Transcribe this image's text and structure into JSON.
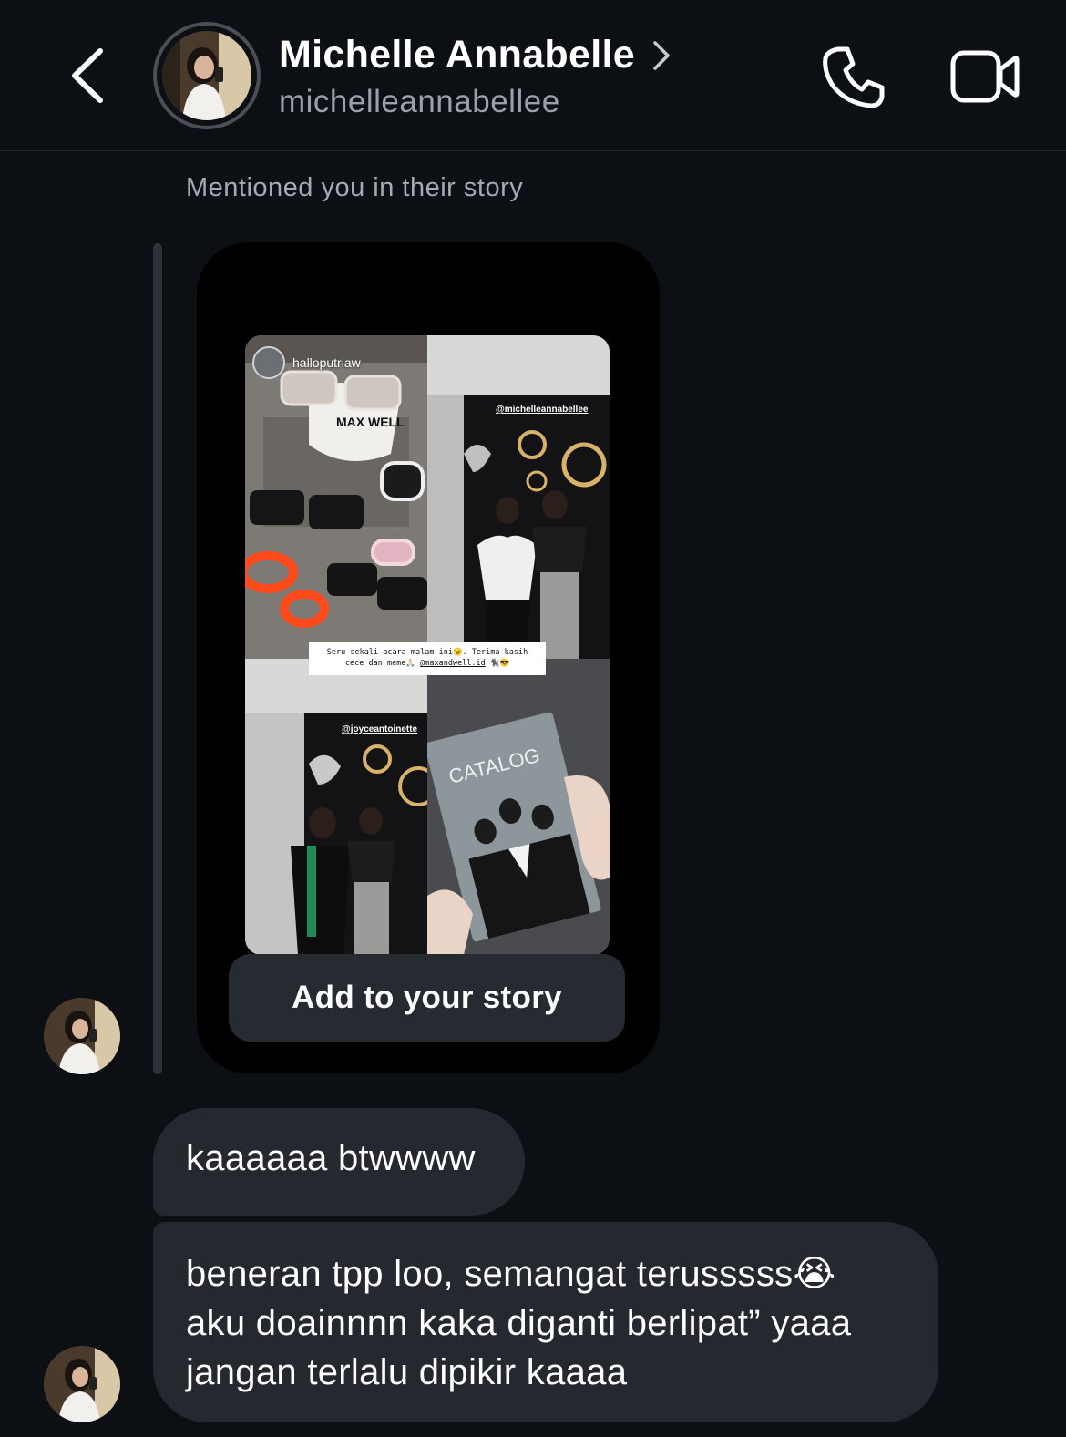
{
  "header": {
    "name": "Michelle Annabelle",
    "username": "michelleannabellee",
    "back_icon": "chevron-left-icon",
    "call_icon": "phone-icon",
    "video_icon": "video-camera-icon"
  },
  "thread": {
    "mention_note": "Mentioned you in their story",
    "story": {
      "poster": "halloputriaw",
      "tag_1": "@michelleannabellee",
      "tag_2": "@joyceantoinette",
      "caption_line_1": "Seru sekali acara malam ini😉. Terima kasih",
      "caption_line_2_prefix": "cece dan meme🙏🏻",
      "caption_mention": "@maxandwell.id",
      "caption_line_2_suffix": "🐈‍⬛😎",
      "hat_text": "MAX WELL",
      "catalog_text": "CATALOG",
      "add_button": "Add to your story"
    },
    "messages": [
      {
        "text": "kaaaaaa btwwww"
      },
      {
        "line_1": "beneran tpp loo, semangat terusssss😭",
        "line_2": "aku doainnnn kaka diganti berlipat” yaaa",
        "line_3": "jangan terlalu dipikir kaaaa"
      }
    ]
  },
  "colors": {
    "background": "#0c0f14",
    "bubble": "#25282f",
    "button": "#262a31",
    "muted_text": "#9aa0a8"
  }
}
